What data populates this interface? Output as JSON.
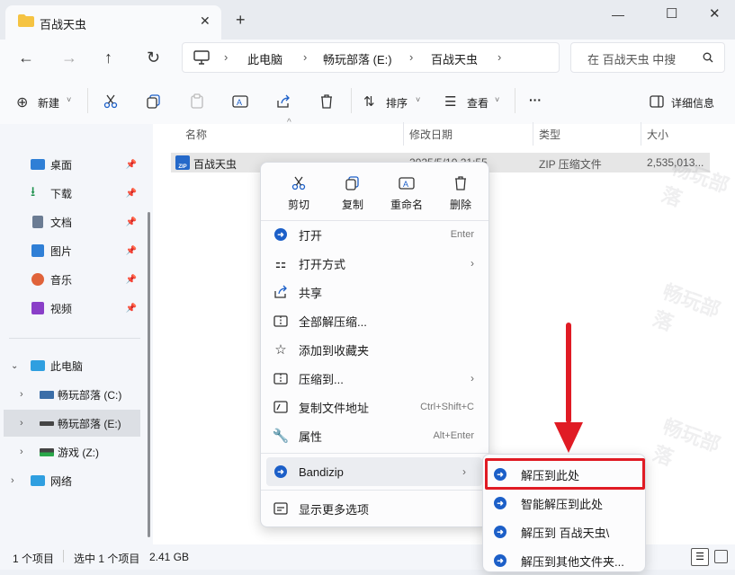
{
  "window": {
    "tab_title": "百战天虫",
    "new_tab": "+",
    "controls": {
      "minimize": "—",
      "maximize": "☐",
      "close": "✕"
    }
  },
  "nav": {
    "back": "←",
    "forward": "→",
    "up": "↑",
    "refresh": "↻",
    "breadcrumb": [
      "此电脑",
      "畅玩部落 (E:)",
      "百战天虫"
    ],
    "search_placeholder": "在 百战天虫 中搜"
  },
  "toolbar": {
    "new_label": "新建",
    "sort_label": "排序",
    "view_label": "查看",
    "more": "···",
    "details_label": "详细信息"
  },
  "sidebar": {
    "quick": [
      {
        "label": "桌面",
        "icon": "desktop-icon",
        "color": "#2f7fd6"
      },
      {
        "label": "下载",
        "icon": "download-icon",
        "color": "#1a8f4a"
      },
      {
        "label": "文档",
        "icon": "document-icon",
        "color": "#6b7c93"
      },
      {
        "label": "图片",
        "icon": "picture-icon",
        "color": "#2f7fd6"
      },
      {
        "label": "音乐",
        "icon": "music-icon",
        "color": "#e0633a"
      },
      {
        "label": "视频",
        "icon": "video-icon",
        "color": "#8a3fc8"
      }
    ],
    "this_pc": "此电脑",
    "drives": [
      {
        "label": "畅玩部落 (C:)"
      },
      {
        "label": "畅玩部落 (E:)"
      },
      {
        "label": "游戏 (Z:)"
      }
    ],
    "network": "网络"
  },
  "columns": {
    "name": "名称",
    "modified": "修改日期",
    "type": "类型",
    "size": "大小"
  },
  "files": [
    {
      "name": "百战天虫",
      "modified": "2025/5/10 21:55",
      "type": "ZIP 压缩文件",
      "size": "2,535,013..."
    }
  ],
  "context_menu": {
    "top": [
      {
        "label": "剪切",
        "icon": "scissors-icon"
      },
      {
        "label": "复制",
        "icon": "copy-icon"
      },
      {
        "label": "重命名",
        "icon": "rename-icon"
      },
      {
        "label": "删除",
        "icon": "trash-icon"
      }
    ],
    "items": [
      {
        "label": "打开",
        "shortcut": "Enter"
      },
      {
        "label": "打开方式",
        "arrow": "›"
      },
      {
        "label": "共享"
      },
      {
        "label": "全部解压缩..."
      },
      {
        "label": "添加到收藏夹"
      },
      {
        "label": "压缩到...",
        "arrow": "›"
      },
      {
        "label": "复制文件地址",
        "shortcut": "Ctrl+Shift+C"
      },
      {
        "label": "属性",
        "shortcut": "Alt+Enter"
      },
      {
        "label": "Bandizip",
        "arrow": "›"
      },
      {
        "label": "显示更多选项"
      }
    ]
  },
  "submenu": [
    {
      "label": "解压到此处"
    },
    {
      "label": "智能解压到此处"
    },
    {
      "label": "解压到 百战天虫\\"
    },
    {
      "label": "解压到其他文件夹..."
    }
  ],
  "status": {
    "count": "1 个项目",
    "selected": "选中 1 个项目",
    "size": "2.41 GB"
  },
  "watermark": "畅玩部落",
  "colors": {
    "accent": "#1c5fc8",
    "highlight_box": "#e01b24",
    "arrow": "#e01b24"
  }
}
